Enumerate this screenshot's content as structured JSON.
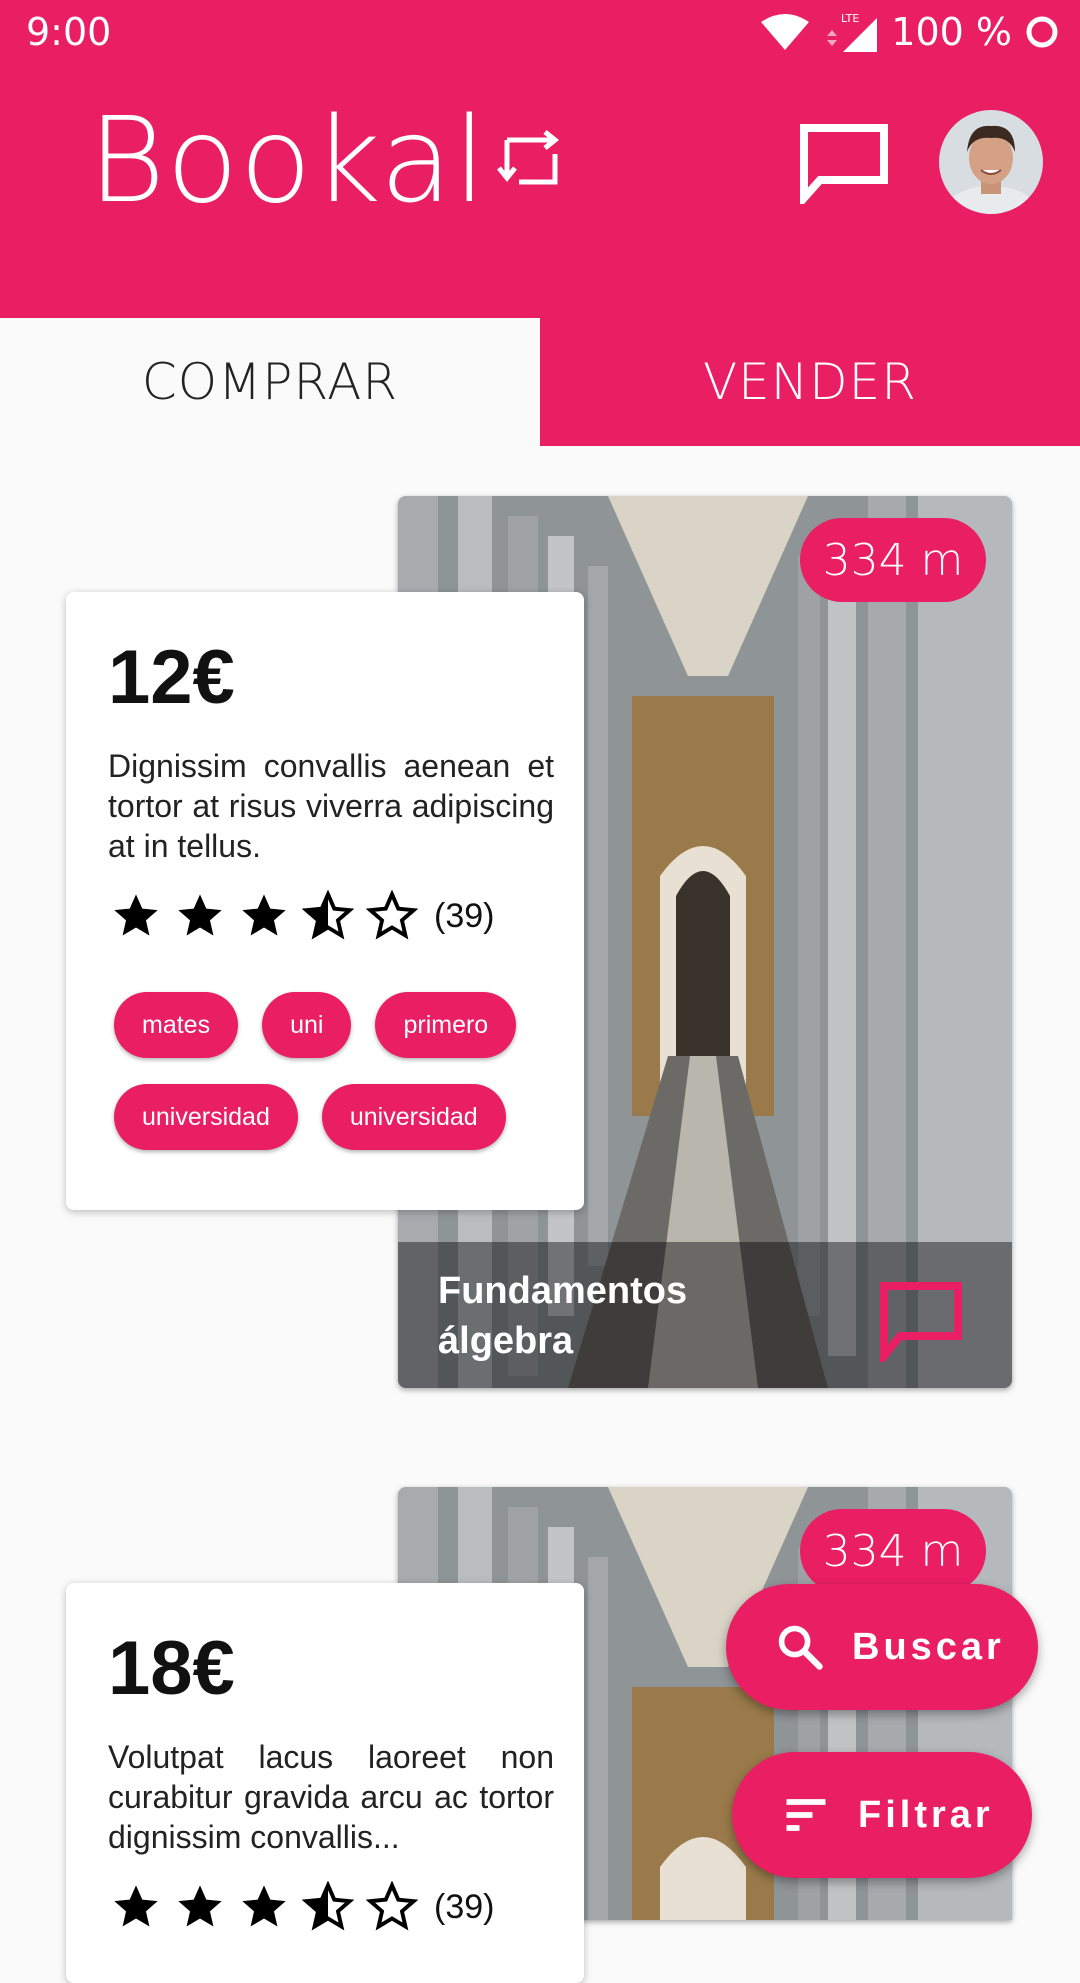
{
  "status_bar": {
    "time": "9:00",
    "network": "LTE",
    "battery": "100 %"
  },
  "header": {
    "logo_text": "Bookal",
    "brand_color": "#e91e63"
  },
  "tabs": [
    {
      "label": "COMPRAR",
      "selected": true
    },
    {
      "label": "VENDER",
      "selected": false
    }
  ],
  "books": [
    {
      "distance": "334 m",
      "title": "Fundamentos álgebra",
      "price": "12€",
      "description": "Dignissim convallis aenean et tortor at risus viverra adipiscing at in tellus.",
      "rating": 3.5,
      "rating_count": "(39)",
      "tags": [
        "mates",
        "uni",
        "primero",
        "universidad",
        "universidad"
      ]
    },
    {
      "distance": "334 m",
      "price": "18€",
      "description": "Volutpat lacus laoreet non curabitur gravida arcu ac tortor dignissim convallis...",
      "rating": 3.5,
      "rating_count": "(39)"
    }
  ],
  "fabs": {
    "search_label": "Buscar",
    "filter_label": "Filtrar"
  }
}
